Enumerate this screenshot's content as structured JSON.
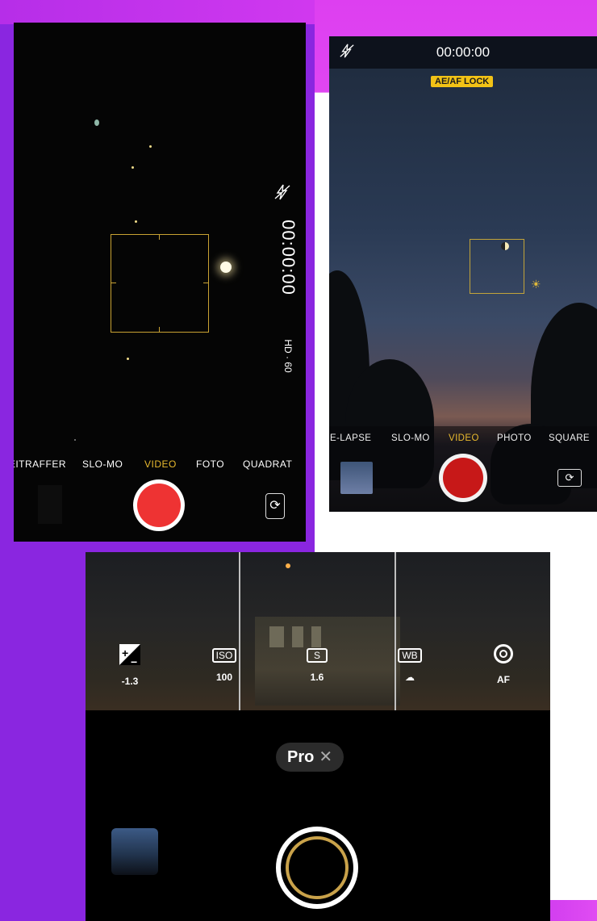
{
  "screen1": {
    "timer": "00:00:00",
    "format": "HD · 60",
    "modes": [
      "ZEITRAFFER",
      "SLO-MO",
      "VIDEO",
      "FOTO",
      "QUADRAT"
    ],
    "active_mode": "VIDEO",
    "flash_icon": "flash-off-icon",
    "switch_icon": "camera-switch-icon",
    "accent": "#e8b92e",
    "record_color": "#ee3333"
  },
  "screen2": {
    "timer": "00:00:00",
    "ae_af_lock": "AE/AF LOCK",
    "modes": [
      "TIME-LAPSE",
      "SLO-MO",
      "VIDEO",
      "PHOTO",
      "SQUARE"
    ],
    "active_mode": "VIDEO",
    "flash_icon": "flash-off-icon",
    "switch_icon": "camera-switch-icon",
    "lock_color": "#f2c216",
    "record_color": "#c71818"
  },
  "screen3": {
    "controls": [
      {
        "id": "ev",
        "icon": "exposure-icon",
        "label": "",
        "value": "-1.3"
      },
      {
        "id": "iso",
        "icon": "iso-icon",
        "label": "ISO",
        "value": "100"
      },
      {
        "id": "shutter",
        "icon": "shutter-speed-icon",
        "label": "S",
        "value": "1.6"
      },
      {
        "id": "wb",
        "icon": "white-balance-icon",
        "label": "WB",
        "value": "☁"
      },
      {
        "id": "af",
        "icon": "autofocus-icon",
        "label": "",
        "value": "AF"
      }
    ],
    "mode_pill": "Pro",
    "close_glyph": "✕",
    "ring_color": "#c9a24a"
  }
}
